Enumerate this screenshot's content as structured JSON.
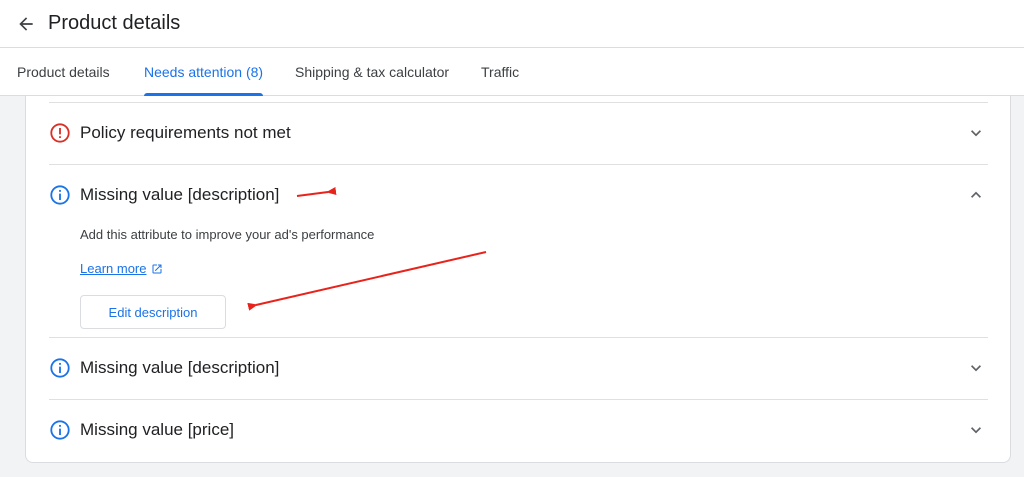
{
  "header": {
    "title": "Product details",
    "back_icon": "arrow-back-icon"
  },
  "tabs": [
    {
      "label": "Product details",
      "active": false
    },
    {
      "label": "Needs attention (8)",
      "active": true
    },
    {
      "label": "Shipping & tax calculator",
      "active": false
    },
    {
      "label": "Traffic",
      "active": false
    }
  ],
  "issues": [
    {
      "title": "Policy requirements not met",
      "icon": "error-icon",
      "expanded": false
    },
    {
      "title": "Missing value [description]",
      "icon": "info-icon",
      "expanded": true,
      "description": "Add this attribute to improve your ad's performance",
      "learn_more_label": "Learn more",
      "action_label": "Edit description"
    },
    {
      "title": "Missing value [description]",
      "icon": "info-icon",
      "expanded": false
    },
    {
      "title": "Missing value [price]",
      "icon": "info-icon",
      "expanded": false
    }
  ],
  "colors": {
    "accent": "#1a73e8",
    "error": "#d93025",
    "annotation_arrow": "#e8231c"
  }
}
